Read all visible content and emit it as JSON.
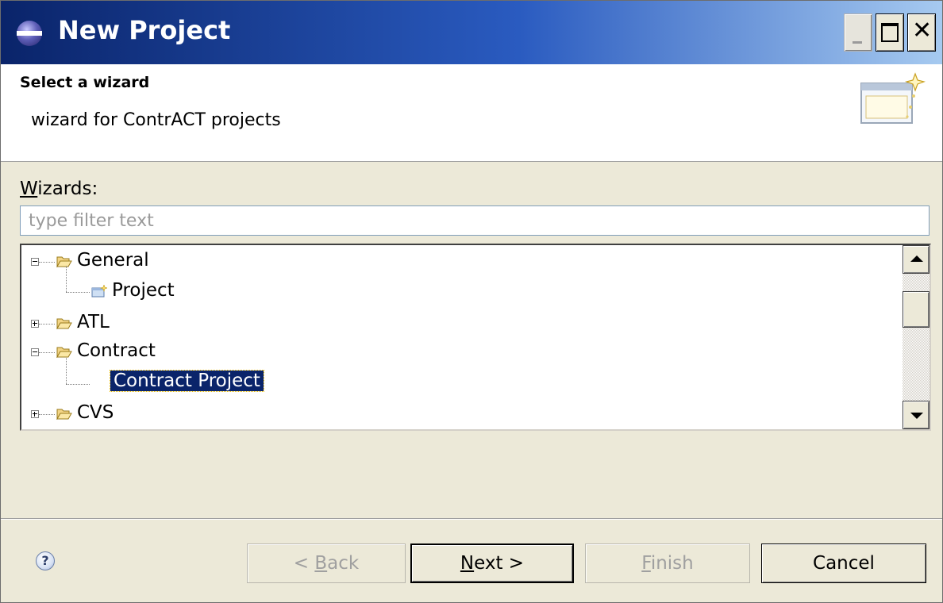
{
  "window": {
    "title": "New Project"
  },
  "header": {
    "title": "Select a wizard",
    "description": "wizard for ContrACT projects"
  },
  "wizards": {
    "label_mnemonic": "W",
    "label_rest": "izards:",
    "filter_placeholder": "type filter text"
  },
  "tree": {
    "items": [
      {
        "label": "General",
        "expanded": true
      },
      {
        "label": "Project"
      },
      {
        "label": "ATL",
        "expanded": false
      },
      {
        "label": "Contract",
        "expanded": true
      },
      {
        "label": "Contract Project",
        "selected": true
      },
      {
        "label": "CVS",
        "expanded": false
      }
    ]
  },
  "buttons": {
    "back": {
      "prefix": "< ",
      "mnemonic": "B",
      "rest": "ack"
    },
    "next": {
      "mnemonic": "N",
      "rest": "ext >"
    },
    "finish": {
      "mnemonic": "F",
      "rest": "inish"
    },
    "cancel": {
      "label": "Cancel"
    }
  },
  "help": {
    "glyph": "?"
  },
  "colors": {
    "selection": "#0a246a",
    "titlebar_start": "#0a246a",
    "titlebar_end": "#a6caf0"
  }
}
